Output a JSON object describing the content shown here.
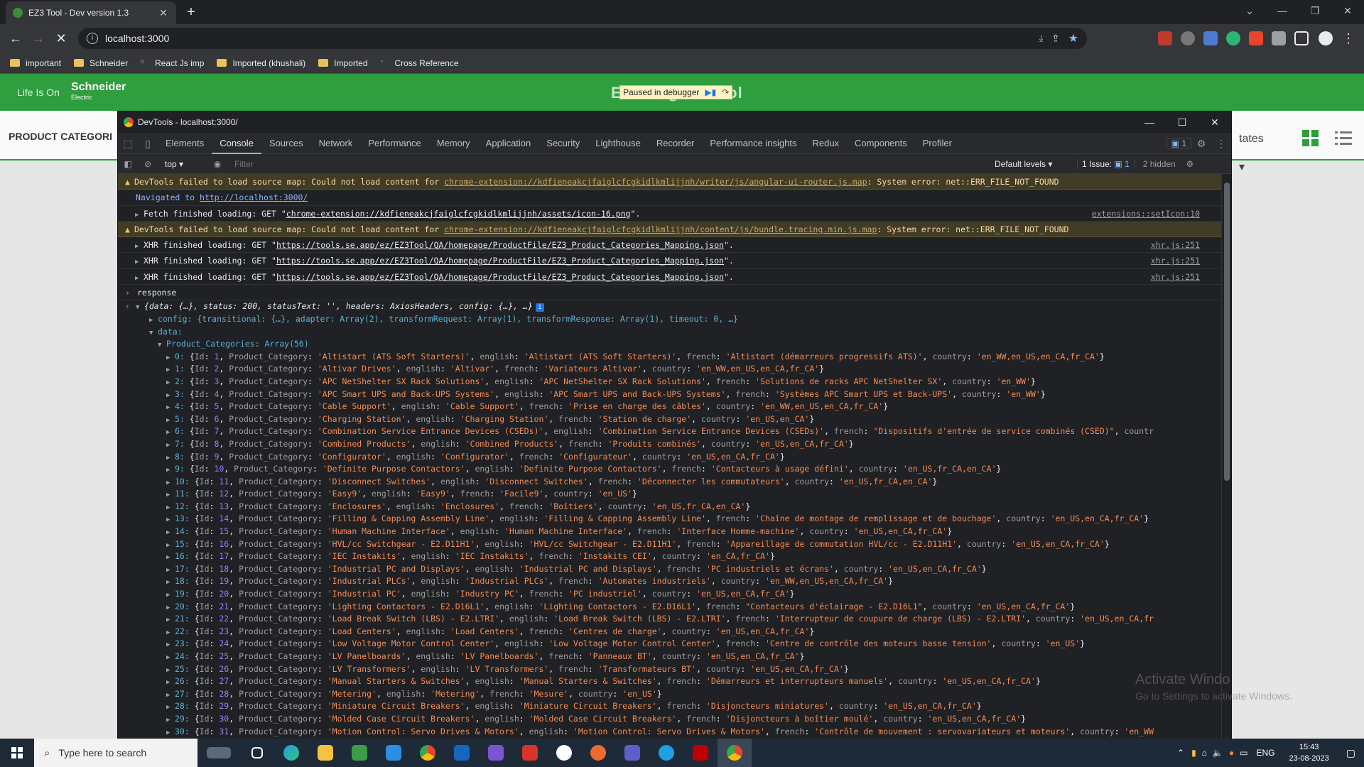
{
  "browser": {
    "tab_title": "EZ3 Tool - Dev version 1.3",
    "url": "localhost:3000",
    "bookmarks": [
      {
        "label": "important",
        "type": "folder"
      },
      {
        "label": "Schneider",
        "type": "folder"
      },
      {
        "label": "React Js imp",
        "type": "site"
      },
      {
        "label": "Imported (khushali)",
        "type": "folder"
      },
      {
        "label": "Imported",
        "type": "folder"
      },
      {
        "label": "Cross Reference",
        "type": "site"
      }
    ]
  },
  "app": {
    "life_is_on": "Life Is On",
    "brand": "Schneider",
    "brand_sub": "Electric",
    "title": "EZ3 Engine Tool",
    "debugger_label": "Paused in debugger",
    "product_categories": "PRODUCT CATEGORI",
    "states": "tates",
    "accent": "#2e9e3e"
  },
  "devtools": {
    "window_title": "DevTools - localhost:3000/",
    "tabs": [
      "Elements",
      "Console",
      "Sources",
      "Network",
      "Performance",
      "Memory",
      "Application",
      "Security",
      "Lighthouse",
      "Recorder",
      "Performance insights",
      "Redux",
      "Components",
      "Profiler"
    ],
    "active_tab": "Console",
    "badge_count": "1",
    "context": "top",
    "filter_placeholder": "Filter",
    "levels": "Default levels",
    "issues": "1 Issue:",
    "issues_count": "1",
    "hidden": "2 hidden",
    "messages": [
      {
        "type": "warn",
        "prefix": "DevTools failed to load source map: Could not load content for ",
        "link": "chrome-extension://kdfieneakcjfaiglcfcgkidlkmlijjnh/writer/js/angular-ui-router.js.map",
        "suffix": ": System error: net::ERR_FILE_NOT_FOUND"
      },
      {
        "type": "nav",
        "prefix": "Navigated to ",
        "link": "http://localhost:3000/"
      },
      {
        "type": "log",
        "text": "Fetch finished loading: GET \"",
        "link": "chrome-extension://kdfieneakcjfaiglcfcgkidlkmlijjnh/assets/icon-16.png",
        "suffix": "\".",
        "source": "extensions::setIcon:10"
      },
      {
        "type": "warn",
        "prefix": "DevTools failed to load source map: Could not load content for ",
        "link": "chrome-extension://kdfieneakcjfaiglcfcgkidlkmlijjnh/content/js/bundle.tracing.min.js.map",
        "suffix": ": System error: net::ERR_FILE_NOT_FOUND"
      },
      {
        "type": "log",
        "text": "XHR finished loading: GET \"",
        "link": "https://tools.se.app/ez/EZ3Tool/QA/homepage/ProductFile/EZ3_Product_Categories_Mapping.json",
        "suffix": "\".",
        "source": "xhr.js:251"
      },
      {
        "type": "log",
        "text": "XHR finished loading: GET \"",
        "link": "https://tools.se.app/ez/EZ3Tool/QA/homepage/ProductFile/EZ3_Product_Categories_Mapping.json",
        "suffix": "\".",
        "source": "xhr.js:251"
      },
      {
        "type": "log",
        "text": "XHR finished loading: GET \"",
        "link": "https://tools.se.app/ez/EZ3Tool/QA/homepage/ProductFile/EZ3_Product_Categories_Mapping.json",
        "suffix": "\".",
        "source": "xhr.js:251"
      }
    ],
    "input_echo": "response",
    "result_summary": "{data: {…}, status: 200, statusText: '', headers: AxiosHeaders, config: {…}, …}",
    "config_line": "config: {transitional: {…}, adapter: Array(2), transformRequest: Array(1), transformResponse: Array(1), timeout: 0, …}",
    "data_label": "data:",
    "product_categories_label": "Product_Categories: Array(56)",
    "categories": [
      {
        "i": "0",
        "id": "1",
        "cat": "Altistart (ATS Soft Starters)",
        "en": "Altistart (ATS Soft Starters)",
        "fr": "Altistart (démarreurs progressifs ATS)",
        "country": "en_WW,en_US,en_CA,fr_CA"
      },
      {
        "i": "1",
        "id": "2",
        "cat": "Altivar Drives",
        "en": "Altivar",
        "fr": "Variateurs Altivar",
        "country": "en_WW,en_US,en_CA,fr_CA"
      },
      {
        "i": "2",
        "id": "3",
        "cat": "APC NetShelter SX Rack Solutions",
        "en": "APC NetShelter SX Rack Solutions",
        "fr": "Solutions de racks APC NetShelter SX",
        "country": "en_WW"
      },
      {
        "i": "3",
        "id": "4",
        "cat": "APC Smart UPS and Back-UPS Systems",
        "en": "APC Smart UPS and Back-UPS Systems",
        "fr": "Systèmes APC Smart UPS et Back-UPS",
        "country": "en_WW"
      },
      {
        "i": "4",
        "id": "5",
        "cat": "Cable Support",
        "en": "Cable Support",
        "fr": "Prise en charge des câbles",
        "country": "en_WW,en_US,en_CA,fr_CA"
      },
      {
        "i": "5",
        "id": "6",
        "cat": "Charging Station",
        "en": "Charging Station",
        "fr": "Station de charge",
        "country": "en_US,en_CA"
      },
      {
        "i": "6",
        "id": "7",
        "cat": "Combination Service Entrance Devices (CSEDs)",
        "en": "Combination Service Entrance Devices (CSEDs)",
        "fr": "Dispositifs d'entrée de service combinés (CSED)",
        "country": "",
        "dq": true,
        "trunc": "countr"
      },
      {
        "i": "7",
        "id": "8",
        "cat": "Combined Products",
        "en": "Combined Products",
        "fr": "Produits combinés",
        "country": "en_US,en_CA,fr_CA"
      },
      {
        "i": "8",
        "id": "9",
        "cat": "Configurator",
        "en": "Configurator",
        "fr": "Configurateur",
        "country": "en_US,en_CA,fr_CA"
      },
      {
        "i": "9",
        "id": "10",
        "cat": "Definite Purpose Contactors",
        "en": "Definite Purpose Contactors",
        "fr": "Contacteurs à usage défini",
        "country": "en_US,fr_CA,en_CA"
      },
      {
        "i": "10",
        "id": "11",
        "cat": "Disconnect Switches",
        "en": "Disconnect Switches",
        "fr": "Déconnecter les commutateurs",
        "country": "en_US,fr_CA,en_CA"
      },
      {
        "i": "11",
        "id": "12",
        "cat": "Easy9",
        "en": "Easy9",
        "fr": "Facile9",
        "country": "en_US"
      },
      {
        "i": "12",
        "id": "13",
        "cat": "Enclosures",
        "en": "Enclosures",
        "fr": "Boîtiers",
        "country": "en_US,fr_CA,en_CA"
      },
      {
        "i": "13",
        "id": "14",
        "cat": "Filling & Capping Assembly Line",
        "en": "Filling & Capping Assembly Line",
        "fr": "Chaîne de montage de remplissage et de bouchage",
        "country": "en_US,en_CA,fr_CA"
      },
      {
        "i": "14",
        "id": "15",
        "cat": "Human Machine Interface",
        "en": "Human Machine Interface",
        "fr": "Interface Homme-machine",
        "country": "en_US,en_CA,fr_CA"
      },
      {
        "i": "15",
        "id": "16",
        "cat": "HVL/cc Switchgear - E2.D11H1",
        "en": "HVL/cc Switchgear - E2.D11H1",
        "fr": "Appareillage de commutation HVL/cc - E2.D11H1",
        "country": "en_US,en_CA,fr_CA"
      },
      {
        "i": "16",
        "id": "17",
        "cat": "IEC Instakits",
        "en": "IEC Instakits",
        "fr": "Instakits CEI",
        "country": "en_CA,fr_CA"
      },
      {
        "i": "17",
        "id": "18",
        "cat": "Industrial PC and Displays",
        "en": "Industrial PC and Displays",
        "fr": "PC industriels et écrans",
        "country": "en_US,en_CA,fr_CA"
      },
      {
        "i": "18",
        "id": "19",
        "cat": "Industrial PLCs",
        "en": "Industrial PLCs",
        "fr": "Automates industriels",
        "country": "en_WW,en_US,en_CA,fr_CA"
      },
      {
        "i": "19",
        "id": "20",
        "cat": "Industrial PC",
        "en": "Industry PC",
        "fr": "PC industriel",
        "country": "en_US,en_CA,fr_CA"
      },
      {
        "i": "20",
        "id": "21",
        "cat": "Lighting Contactors - E2.D16L1",
        "en": "Lighting Contactors - E2.D16L1",
        "fr": "Contacteurs d'éclairage - E2.D16L1",
        "country": "en_US,en_CA,fr_CA",
        "frdq": true
      },
      {
        "i": "21",
        "id": "22",
        "cat": "Load Break Switch (LBS) - E2.LTRI",
        "en": "Load Break Switch (LBS) - E2.LTRI",
        "fr": "Interrupteur de coupure de charge (LBS) - E2.LTRI",
        "country": "en_US,en_CA,fr",
        "open": true
      },
      {
        "i": "22",
        "id": "23",
        "cat": "Load Centers",
        "en": "Load Centers",
        "fr": "Centres de charge",
        "country": "en_US,en_CA,fr_CA"
      },
      {
        "i": "23",
        "id": "24",
        "cat": "Low Voltage Motor Control Center",
        "en": "Low Voltage Motor Control Center",
        "fr": "Centre de contrôle des moteurs basse tension",
        "country": "en_US"
      },
      {
        "i": "24",
        "id": "25",
        "cat": "LV Panelboards",
        "en": "LV Panelboards",
        "fr": "Panneaux BT",
        "country": "en_US,en_CA,fr_CA"
      },
      {
        "i": "25",
        "id": "26",
        "cat": "LV Transformers",
        "en": "LV Transformers",
        "fr": "Transformateurs BT",
        "country": "en_US,en_CA,fr_CA"
      },
      {
        "i": "26",
        "id": "27",
        "cat": "Manual Starters & Switches",
        "en": "Manual Starters & Switches",
        "fr": "Démarreurs et interrupteurs manuels",
        "country": "en_US,en_CA,fr_CA"
      },
      {
        "i": "27",
        "id": "28",
        "cat": "Metering",
        "en": "Metering",
        "fr": "Mesure",
        "country": "en_US"
      },
      {
        "i": "28",
        "id": "29",
        "cat": "Miniature Circuit Breakers",
        "en": "Miniature Circuit Breakers",
        "fr": "Disjoncteurs miniatures",
        "country": "en_US,en_CA,fr_CA"
      },
      {
        "i": "29",
        "id": "30",
        "cat": "Molded Case Circuit Breakers",
        "en": "Molded Case Circuit Breakers",
        "fr": "Disjoncteurs à boîtier moulé",
        "country": "en_US,en_CA,fr_CA"
      },
      {
        "i": "30",
        "id": "31",
        "cat": "Motion Control: Servo Drives & Motors",
        "en": "Motion Control: Servo Drives & Motors",
        "fr": "Contrôle de mouvement : servovariateurs et moteurs",
        "country": "en_WW",
        "open": true
      }
    ]
  },
  "overlay": {
    "activate_title": "Activate Windo",
    "activate_sub": "Go to Settings to activate Windows."
  },
  "taskbar": {
    "search_placeholder": "Type here to search",
    "lang": "ENG",
    "time": "15:43",
    "date": "23-08-2023"
  }
}
